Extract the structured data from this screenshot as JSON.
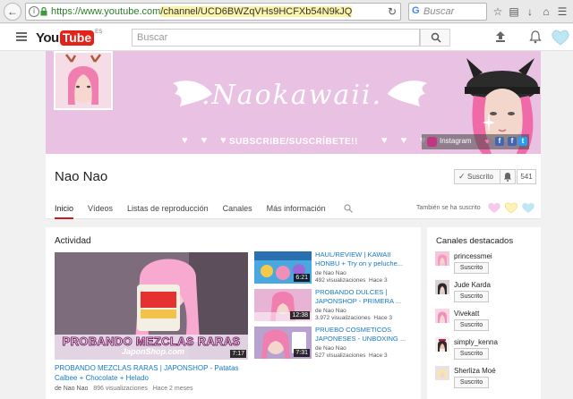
{
  "browser": {
    "url_prefix": "https://www.youtube.com",
    "url_path": "/channel/UCD6BWZqVHs9HCFXb54N9kJQ",
    "search_placeholder": "Buscar"
  },
  "header": {
    "logo_you": "You",
    "logo_tube": "Tube",
    "logo_region": "ES",
    "search_placeholder": "Buscar"
  },
  "banner": {
    "title": ".Naokawaii.",
    "subscribe_text": "SUBSCRIBE/SUSCRÍBETE!!",
    "hearts": "♥ ♥ ♥",
    "instagram_label": "Instagram"
  },
  "channel": {
    "name": "Nao Nao",
    "subscribe_label": "Suscrito",
    "subscriber_count": "541",
    "tabs": [
      "Inicio",
      "Vídeos",
      "Listas de reproducción",
      "Canales",
      "Más información"
    ],
    "also_subscribed": "También se ha suscrito"
  },
  "activity": {
    "title": "Actividad",
    "main_video": {
      "caption": "PROBANDO MEZCLAS RARAS",
      "site": "JaponShop.com",
      "duration": "7:17",
      "title": "PROBANDO MEZCLAS RARAS | JAPONSHOP - Patatas Calbee + Chocolate + Helado",
      "author": "de Nao Nao",
      "views": "896 visualizaciones",
      "age": "Hace 2 meses"
    },
    "side_videos": [
      {
        "title": "HAUL/REVIEW | KAWAII HONBU + Try on y peluche...",
        "author": "de Nao Nao",
        "views": "492 visualizaciones",
        "age": "Hace 3",
        "duration": "6:21"
      },
      {
        "title": "PROBANDO DULCES | JAPONSHOP - PRIMERA ...",
        "author": "de Nao Nao",
        "views": "3.972 visualizaciones",
        "age": "Hace 3",
        "duration": "12:38"
      },
      {
        "title": "PRUEBO COSMETICOS JAPONESES - UNBOXING ...",
        "author": "de Nao Nao",
        "views": "527 visualizaciones",
        "age": "Hace 3",
        "duration": "7:31"
      }
    ]
  },
  "featured": {
    "title": "Canales destacados",
    "channels": [
      {
        "name": "princessmei",
        "button": "Suscrito"
      },
      {
        "name": "Jude Karda",
        "button": "Suscrito"
      },
      {
        "name": "Vivekatt",
        "button": "Suscrito"
      },
      {
        "name": "simply_kenna",
        "button": "Suscrito"
      },
      {
        "name": "Sherliza Moé",
        "button": "Suscrito"
      }
    ]
  },
  "colors": {
    "youtube_red": "#e62117",
    "link_blue": "#167ac6",
    "banner_pink": "#e9c2e3",
    "active_tab": "#cc181e"
  }
}
